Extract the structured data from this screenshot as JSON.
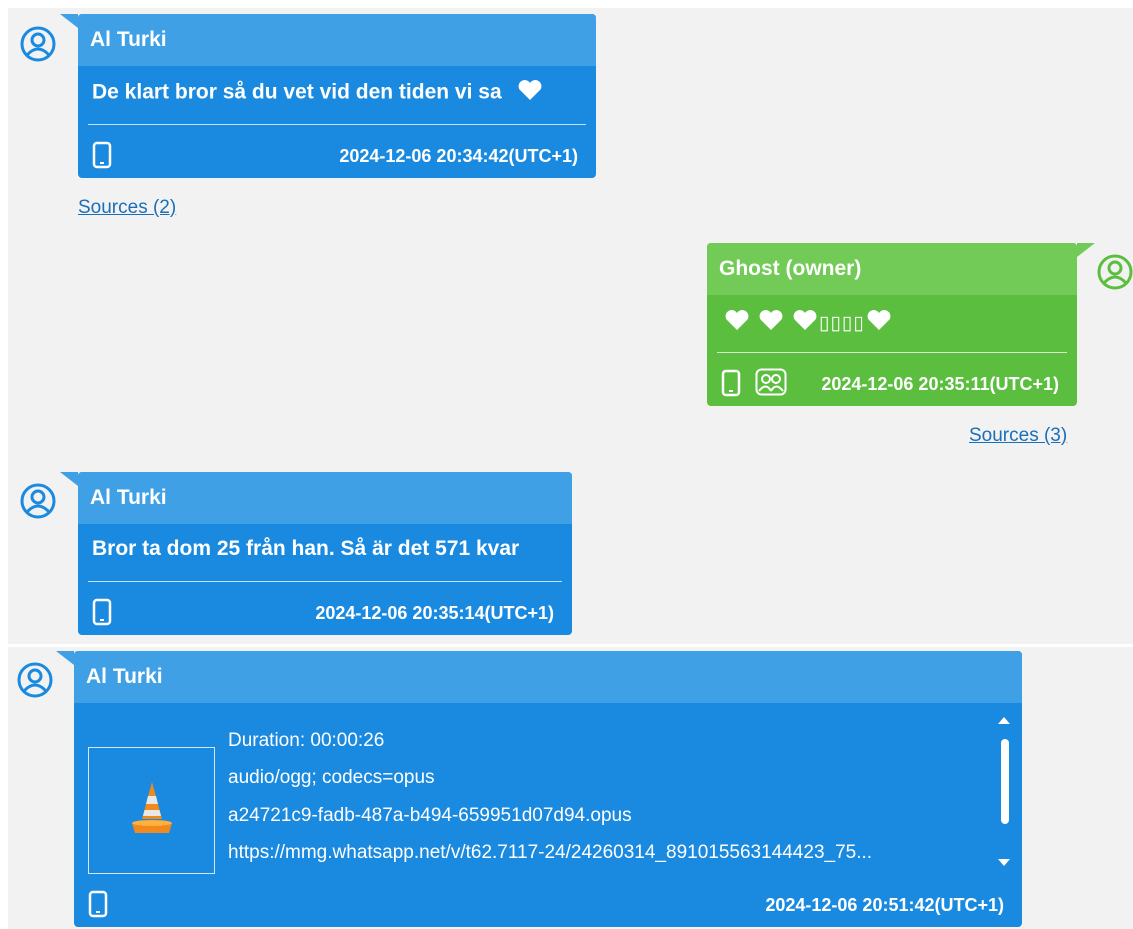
{
  "messages": [
    {
      "sender": "Al Turki",
      "text": "De klart bror så du vet vid den tiden vi sa",
      "timestamp": "2024-12-06 20:34:42(UTC+1)",
      "sources": "Sources (2)",
      "icons": [
        "user-avatar-icon",
        "heart-icon",
        "phone-icon"
      ]
    },
    {
      "sender": "Ghost (owner)",
      "text": "▯▯▯▯",
      "timestamp": "2024-12-06 20:35:11(UTC+1)",
      "sources": "Sources (3)",
      "icons": [
        "user-avatar-icon",
        "heart-icon",
        "phone-icon",
        "group-icon"
      ]
    },
    {
      "sender": "Al Turki",
      "text": "Bror ta dom 25 från han. Så är det 571 kvar",
      "timestamp": "2024-12-06 20:35:14(UTC+1)",
      "icons": [
        "user-avatar-icon",
        "phone-icon"
      ]
    },
    {
      "sender": "Al Turki",
      "attachment": {
        "duration": "Duration: 00:00:26",
        "mime": "audio/ogg; codecs=opus",
        "filename": "a24721c9-fadb-487a-b494-659951d07d94.opus",
        "url": "https://mmg.whatsapp.net/v/t62.7117-24/24260314_891015563144423_75..."
      },
      "timestamp": "2024-12-06 20:51:42(UTC+1)",
      "icons": [
        "user-avatar-icon",
        "vlc-cone-icon",
        "phone-icon"
      ]
    }
  ],
  "colors": {
    "incoming_bubble": "#1a8ae0",
    "incoming_header": "#3fa0e6",
    "outgoing_bubble": "#5cbe3e",
    "outgoing_header": "#72cb57",
    "link": "#1a6fb8",
    "background": "#f2f2f2"
  }
}
